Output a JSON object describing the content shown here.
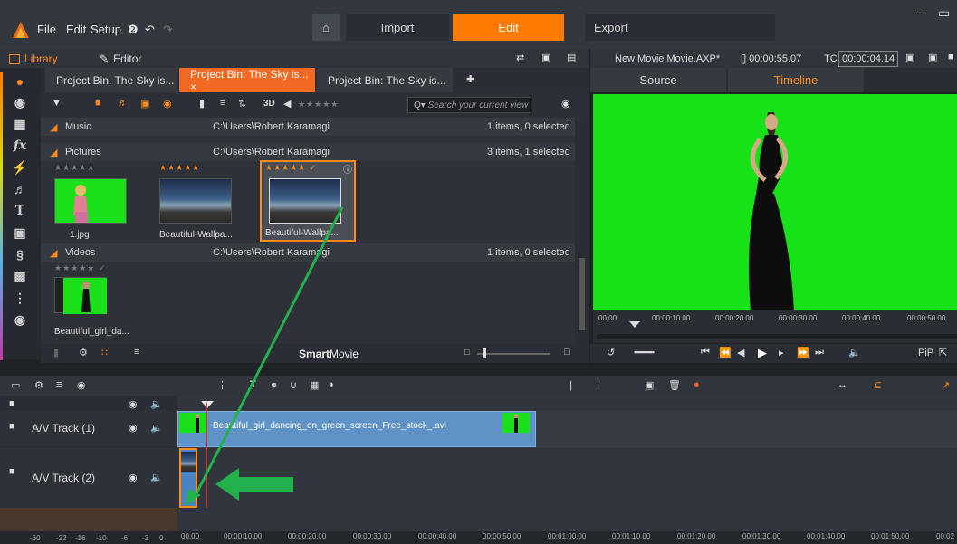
{
  "menubar": {
    "file": "File",
    "edit": "Edit",
    "setup": "Setup",
    "help": "❷",
    "home": "⌂",
    "import": "Import",
    "edit_mode": "Edit",
    "export": "Export"
  },
  "library": {
    "tab_library": "Library",
    "tab_editor": "Editor"
  },
  "bin_tabs": [
    "Project Bin: The Sky is...",
    "Project Bin: The Sky is... ×",
    "Project Bin: The Sky is..."
  ],
  "toolbar": {
    "label_3d": "3D",
    "stars": "★★★★★",
    "search_placeholder": "Search your current view"
  },
  "groups": {
    "music": {
      "name": "Music",
      "path": "C:\\Users\\Robert Karamagi",
      "count": "1 items, 0 selected"
    },
    "pictures": {
      "name": "Pictures",
      "path": "C:\\Users\\Robert Karamagi",
      "count": "3 items, 1 selected"
    },
    "videos": {
      "name": "Videos",
      "path": "C:\\Users\\Robert Karamagi",
      "count": "1 items, 0 selected"
    }
  },
  "pictures_items": [
    {
      "name": "1.jpg",
      "stars": "★★★★★"
    },
    {
      "name": "Beautiful-Wallpa...",
      "stars": "★★★★★"
    },
    {
      "name": "Beautiful-Wallpa...",
      "stars": "★★★★★ ✓"
    }
  ],
  "videos_items": [
    {
      "name": "Beautiful_girl_da...",
      "stars": "★★★★★ ✓"
    }
  ],
  "smart_movie": {
    "bold": "Smart",
    "rest": "Movie"
  },
  "player": {
    "title": "New Movie.Movie.AXP*",
    "tc1": "[] 00:00:55.07",
    "tc_label": "TC",
    "tc2": "00:00:04.14",
    "tab_source": "Source",
    "tab_timeline": "Timeline",
    "ruler": [
      "00.00",
      "00:00:10.00",
      "00:00:20.00",
      "00:00:30.00",
      "00:00:40.00",
      "00:00:50.00"
    ],
    "pip": "PiP"
  },
  "tracks": [
    {
      "label": "A/V Track (1)"
    },
    {
      "label": "A/V Track (2)"
    }
  ],
  "clip1": {
    "name": "Beautiful_girl_dancing_on_green_screen_Free_stock_.avi"
  },
  "tl_ruler": [
    "-60",
    "-22",
    "-16",
    "-10",
    "-6",
    "-3",
    "0",
    "00.00",
    "00:00:10.00",
    "00:00:20.00",
    "00:00:30.00",
    "00:00:40.00",
    "00:00:50.00",
    "00:01:00.00",
    "00:01:10.00",
    "00:01:20.00",
    "00:01:30.00",
    "00:01:40.00",
    "00:01:50.00",
    "00:02"
  ],
  "colors": {
    "accent": "#ff7a00",
    "green_screen": "#17e217",
    "clip": "#5f93c8",
    "arrow": "#22b14c"
  }
}
